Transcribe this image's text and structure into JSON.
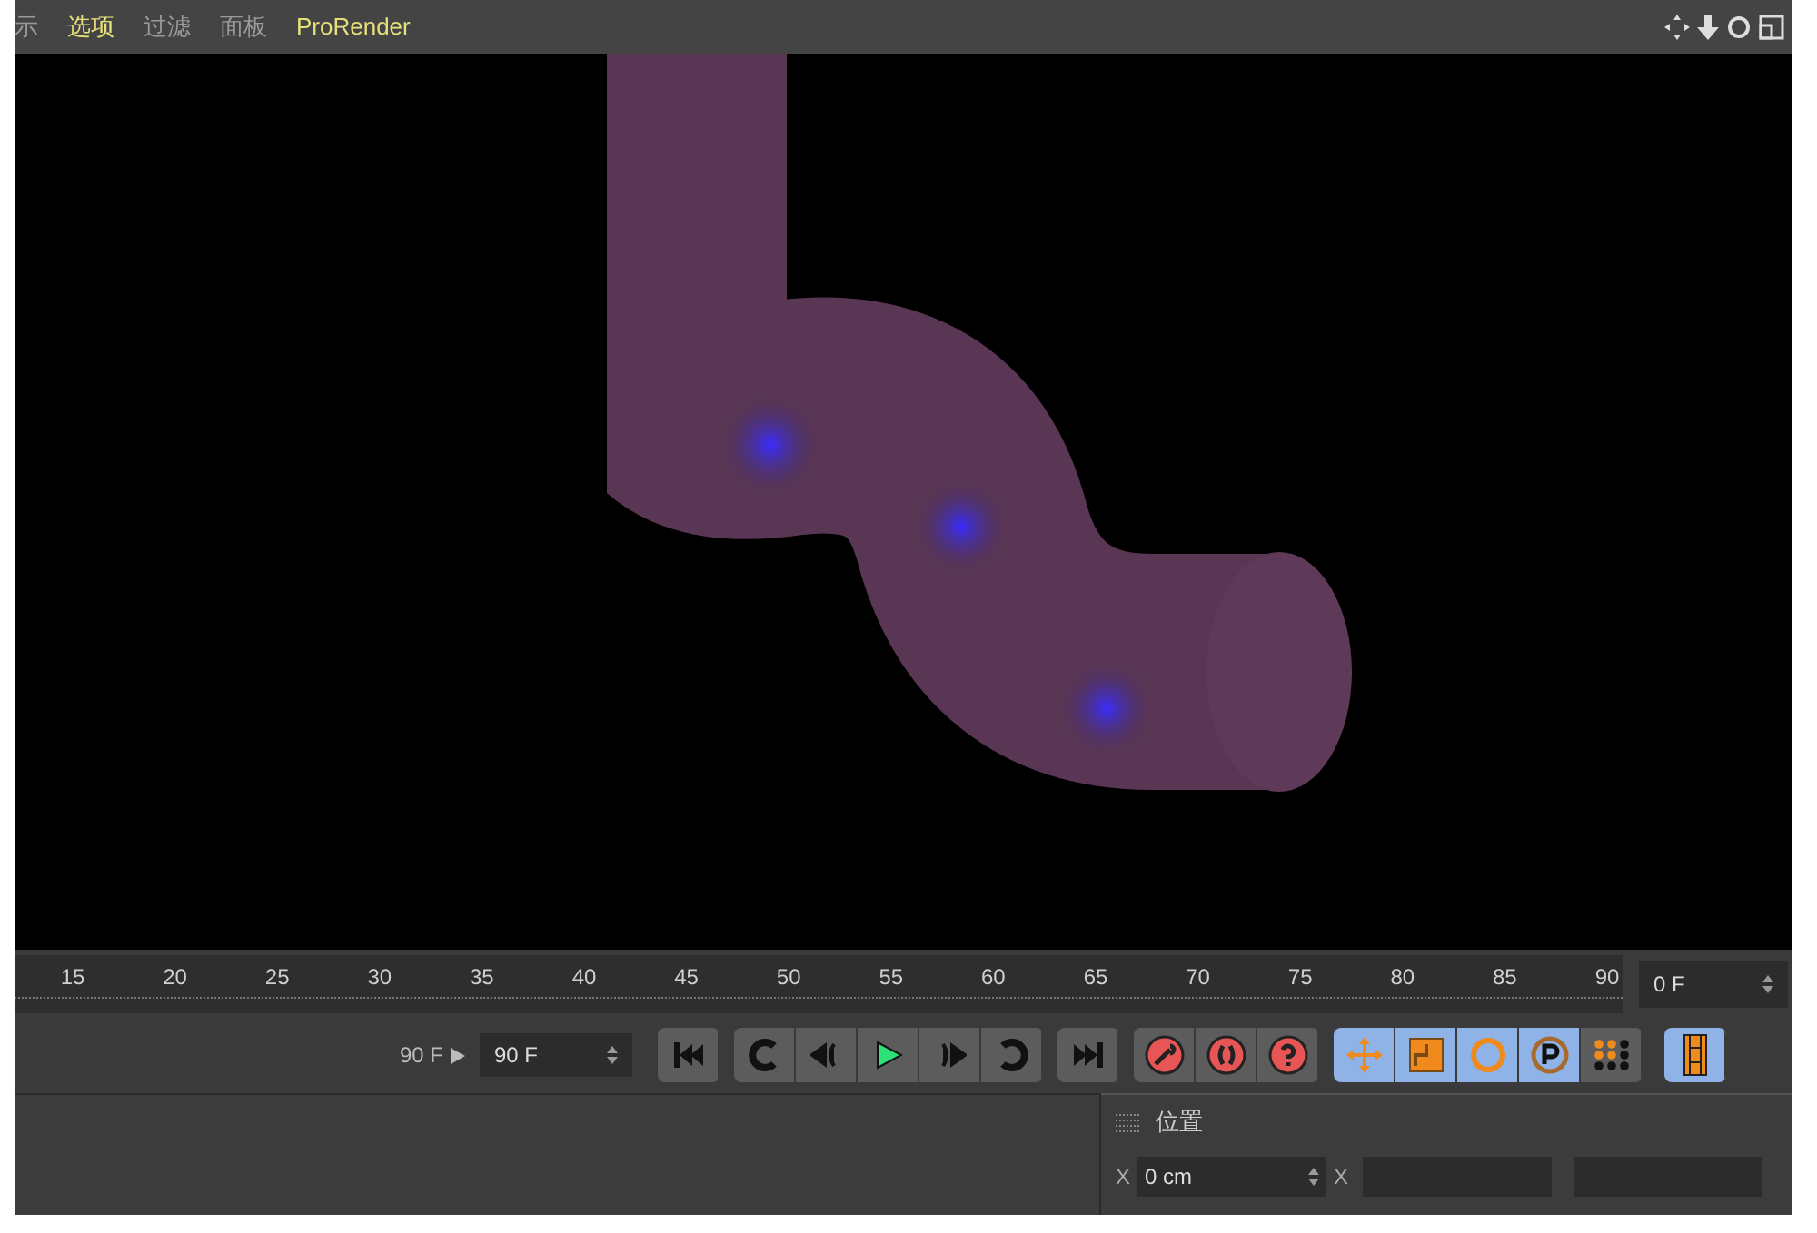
{
  "menu": [
    {
      "label": "示",
      "highlighted": false
    },
    {
      "label": "选项",
      "highlighted": true
    },
    {
      "label": "过滤",
      "highlighted": false
    },
    {
      "label": "面板",
      "highlighted": false
    },
    {
      "label": "ProRender",
      "highlighted": true
    }
  ],
  "timeline": {
    "ticks": [
      "15",
      "20",
      "25",
      "30",
      "35",
      "40",
      "45",
      "50",
      "55",
      "60",
      "65",
      "70",
      "75",
      "80",
      "85",
      "90"
    ],
    "current_frame": "0 F"
  },
  "controls": {
    "min_field": "90 F",
    "max_field": "90 F",
    "toggles": [
      {
        "kind": "move",
        "on": true
      },
      {
        "kind": "scale",
        "on": true
      },
      {
        "kind": "rotate",
        "on": true
      },
      {
        "kind": "param",
        "on": true
      },
      {
        "kind": "grid",
        "on": false
      }
    ]
  },
  "attributes": {
    "title": "位置",
    "rows": [
      {
        "axis": "X",
        "value": "0 cm"
      }
    ],
    "second_axis": "X"
  }
}
